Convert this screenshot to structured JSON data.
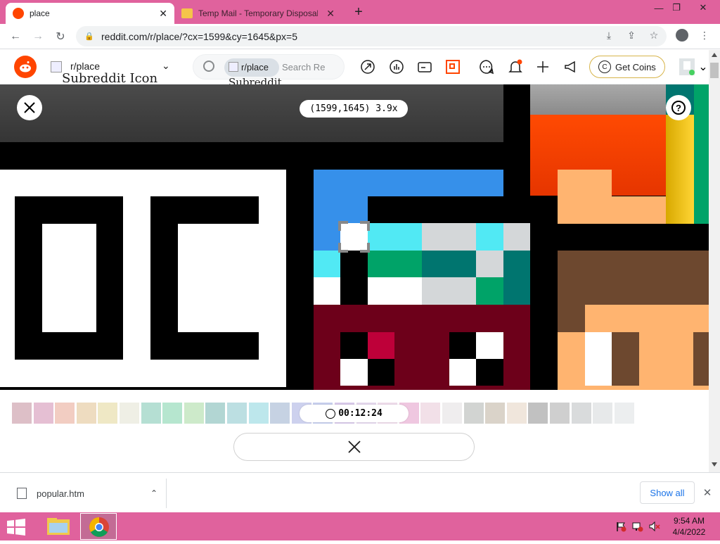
{
  "browser": {
    "tabs": [
      {
        "title": "place",
        "active": true
      },
      {
        "title": "Temp Mail - Temporary Disposab",
        "active": false
      }
    ],
    "new_tab_label": "+",
    "url": "reddit.com/r/place/?cx=1599&cy=1645&px=5"
  },
  "reddit": {
    "community_label": "r/place",
    "community_icon_alt": "Subreddit Icon",
    "search_chip_label": "r/place",
    "search_chip_alt": "Subreddit",
    "search_placeholder": "Search Re",
    "get_coins_label": "Get Coins"
  },
  "place": {
    "coordinates": "(1599,1645) 3.9x",
    "timer": "00:12:24",
    "palette_colors": [
      "#ddbfc7",
      "#e5bfd3",
      "#f2cdc2",
      "#eedcc0",
      "#efe8c5",
      "#efefe5",
      "#b5dfd3",
      "#b6e6cf",
      "#cdeaca",
      "#b2d6d3",
      "#bcdfe2",
      "#bde7ec",
      "#c6d2e3",
      "#cdd1ee",
      "#c8d0ee",
      "#d9caea",
      "#e5d8ed",
      "#efddeb",
      "#efc7e0",
      "#f2e0e8",
      "#efedee",
      "#d2d4d2",
      "#dad3c9",
      "#f0e6dc",
      "#c1c1c1",
      "#cfcfcf",
      "#d9dbdc",
      "#e7e9ea",
      "#eceeef"
    ]
  },
  "downloads": {
    "file_name": "popular.htm",
    "show_all_label": "Show all"
  },
  "taskbar": {
    "time": "9:54 AM",
    "date": "4/4/2022"
  }
}
